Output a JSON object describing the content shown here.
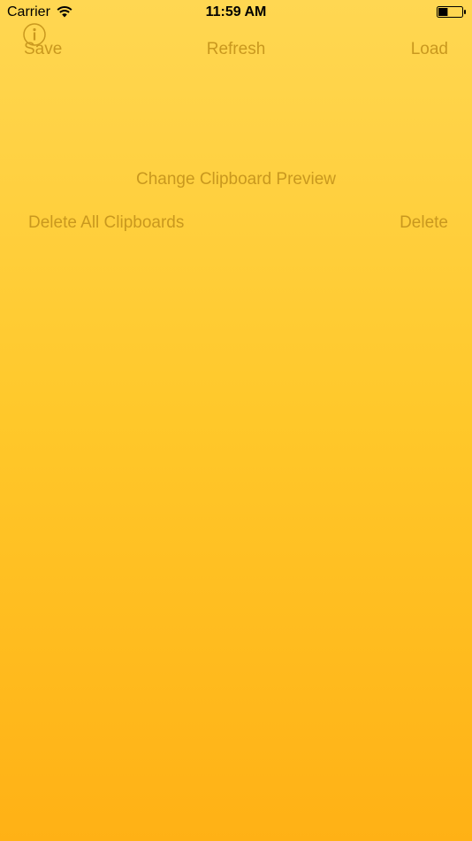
{
  "status_bar": {
    "carrier": "Carrier",
    "time": "11:59 AM",
    "battery_level": 0.4,
    "wifi_icon": "wifi-icon",
    "battery_icon": "battery-icon"
  },
  "toolbar": {
    "info_icon": "info-icon",
    "save_label": "Save",
    "refresh_label": "Refresh",
    "load_label": "Load"
  },
  "actions": {
    "change_preview_label": "Change Clipboard Preview",
    "delete_all_label": "Delete All Clipboards",
    "delete_label": "Delete"
  },
  "colors": {
    "background_top": "#FFD752",
    "background_bottom": "#FFB115",
    "button_text": "#C9981E"
  }
}
